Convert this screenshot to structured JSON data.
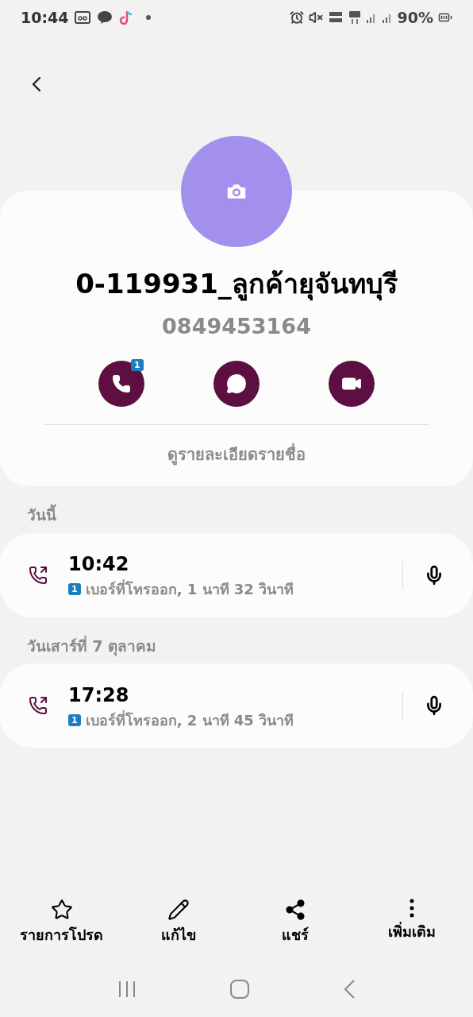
{
  "status_bar": {
    "time": "10:44",
    "battery": "90%"
  },
  "contact": {
    "name": "0-119931_ลูกค้ายุจันทบุรี",
    "phone": "0849453164",
    "call_badge": "1",
    "details_link": "ดูรายละเอียดรายชื่อ"
  },
  "call_groups": [
    {
      "date": "วันนี้",
      "calls": [
        {
          "kind": "outgoing",
          "time": "10:42",
          "sim": "1",
          "description": "เบอร์ที่โทรออก, 1 นาที 32 วินาที"
        }
      ]
    },
    {
      "date": "วันเสาร์ที่ 7 ตุลาคม",
      "calls": [
        {
          "kind": "outgoing",
          "time": "17:28",
          "sim": "1",
          "description": "เบอร์ที่โทรออก, 2 นาที 45 วินาที"
        }
      ]
    }
  ],
  "bottom_actions": [
    {
      "kind": "favorite",
      "label": "รายการโปรด"
    },
    {
      "kind": "edit",
      "label": "แก้ไข"
    },
    {
      "kind": "share",
      "label": "แชร์"
    },
    {
      "kind": "more",
      "label": "เพิ่มเติม"
    }
  ]
}
